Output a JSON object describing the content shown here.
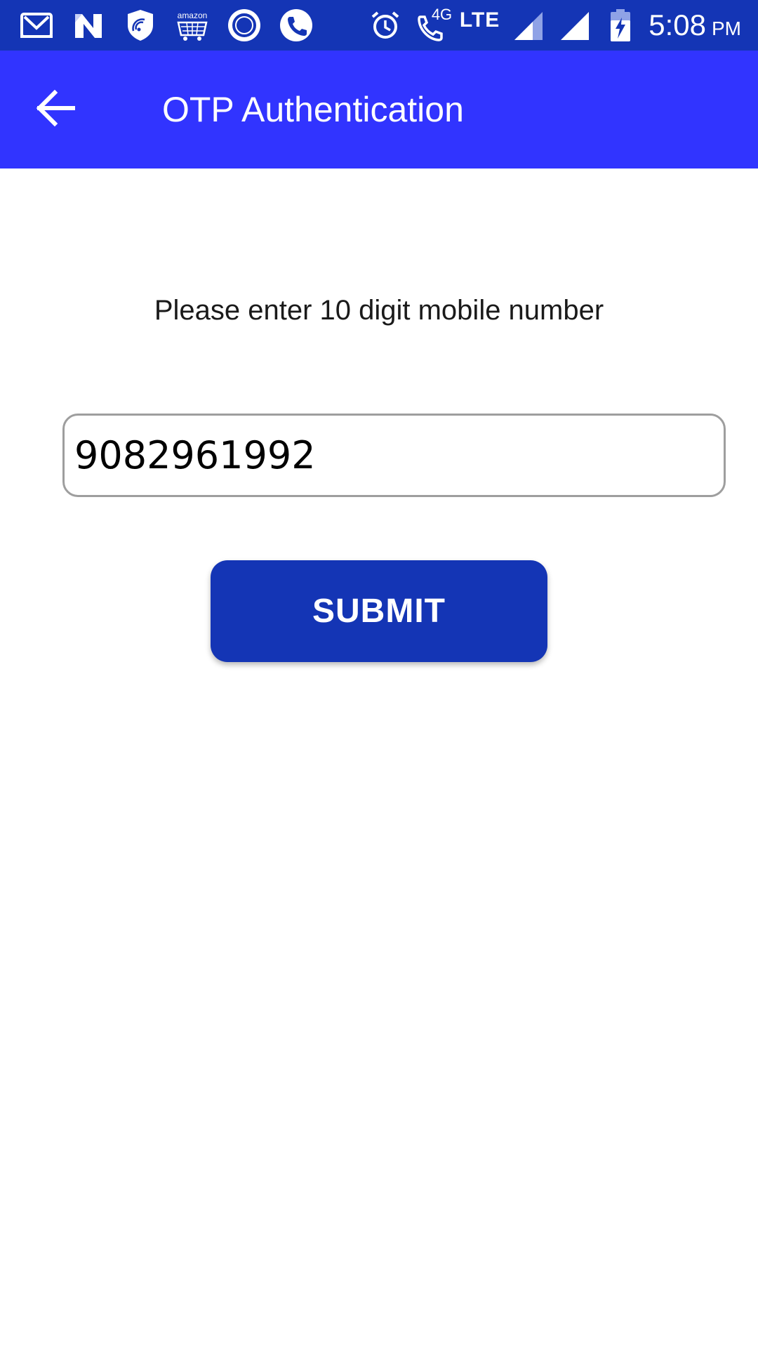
{
  "status_bar": {
    "notification_icons": [
      "gmail-icon",
      "n-app-icon",
      "shield-wifi-icon",
      "amazon-cart-icon",
      "circle-app-icon",
      "phone-app-icon"
    ],
    "amazon_text": "amazon",
    "alarm_icon": "alarm-icon",
    "call_icon": "wifi-call-icon",
    "call_4g": "4G",
    "network_text": "LTE",
    "signal_icons": [
      "signal-sim1-icon",
      "signal-sim2-icon"
    ],
    "battery_icon": "battery-charging-icon",
    "time": "5:08",
    "ampm": "PM"
  },
  "app_bar": {
    "back_icon": "arrow-left-icon",
    "title": "OTP Authentication"
  },
  "form": {
    "instruction": "Please enter 10 digit mobile number",
    "phone_value": "9082961992",
    "submit_label": "SUBMIT"
  },
  "colors": {
    "status_bar": "#1435b5",
    "app_bar": "#3134ff",
    "button": "#1435b5",
    "input_border": "#9e9e9e"
  }
}
